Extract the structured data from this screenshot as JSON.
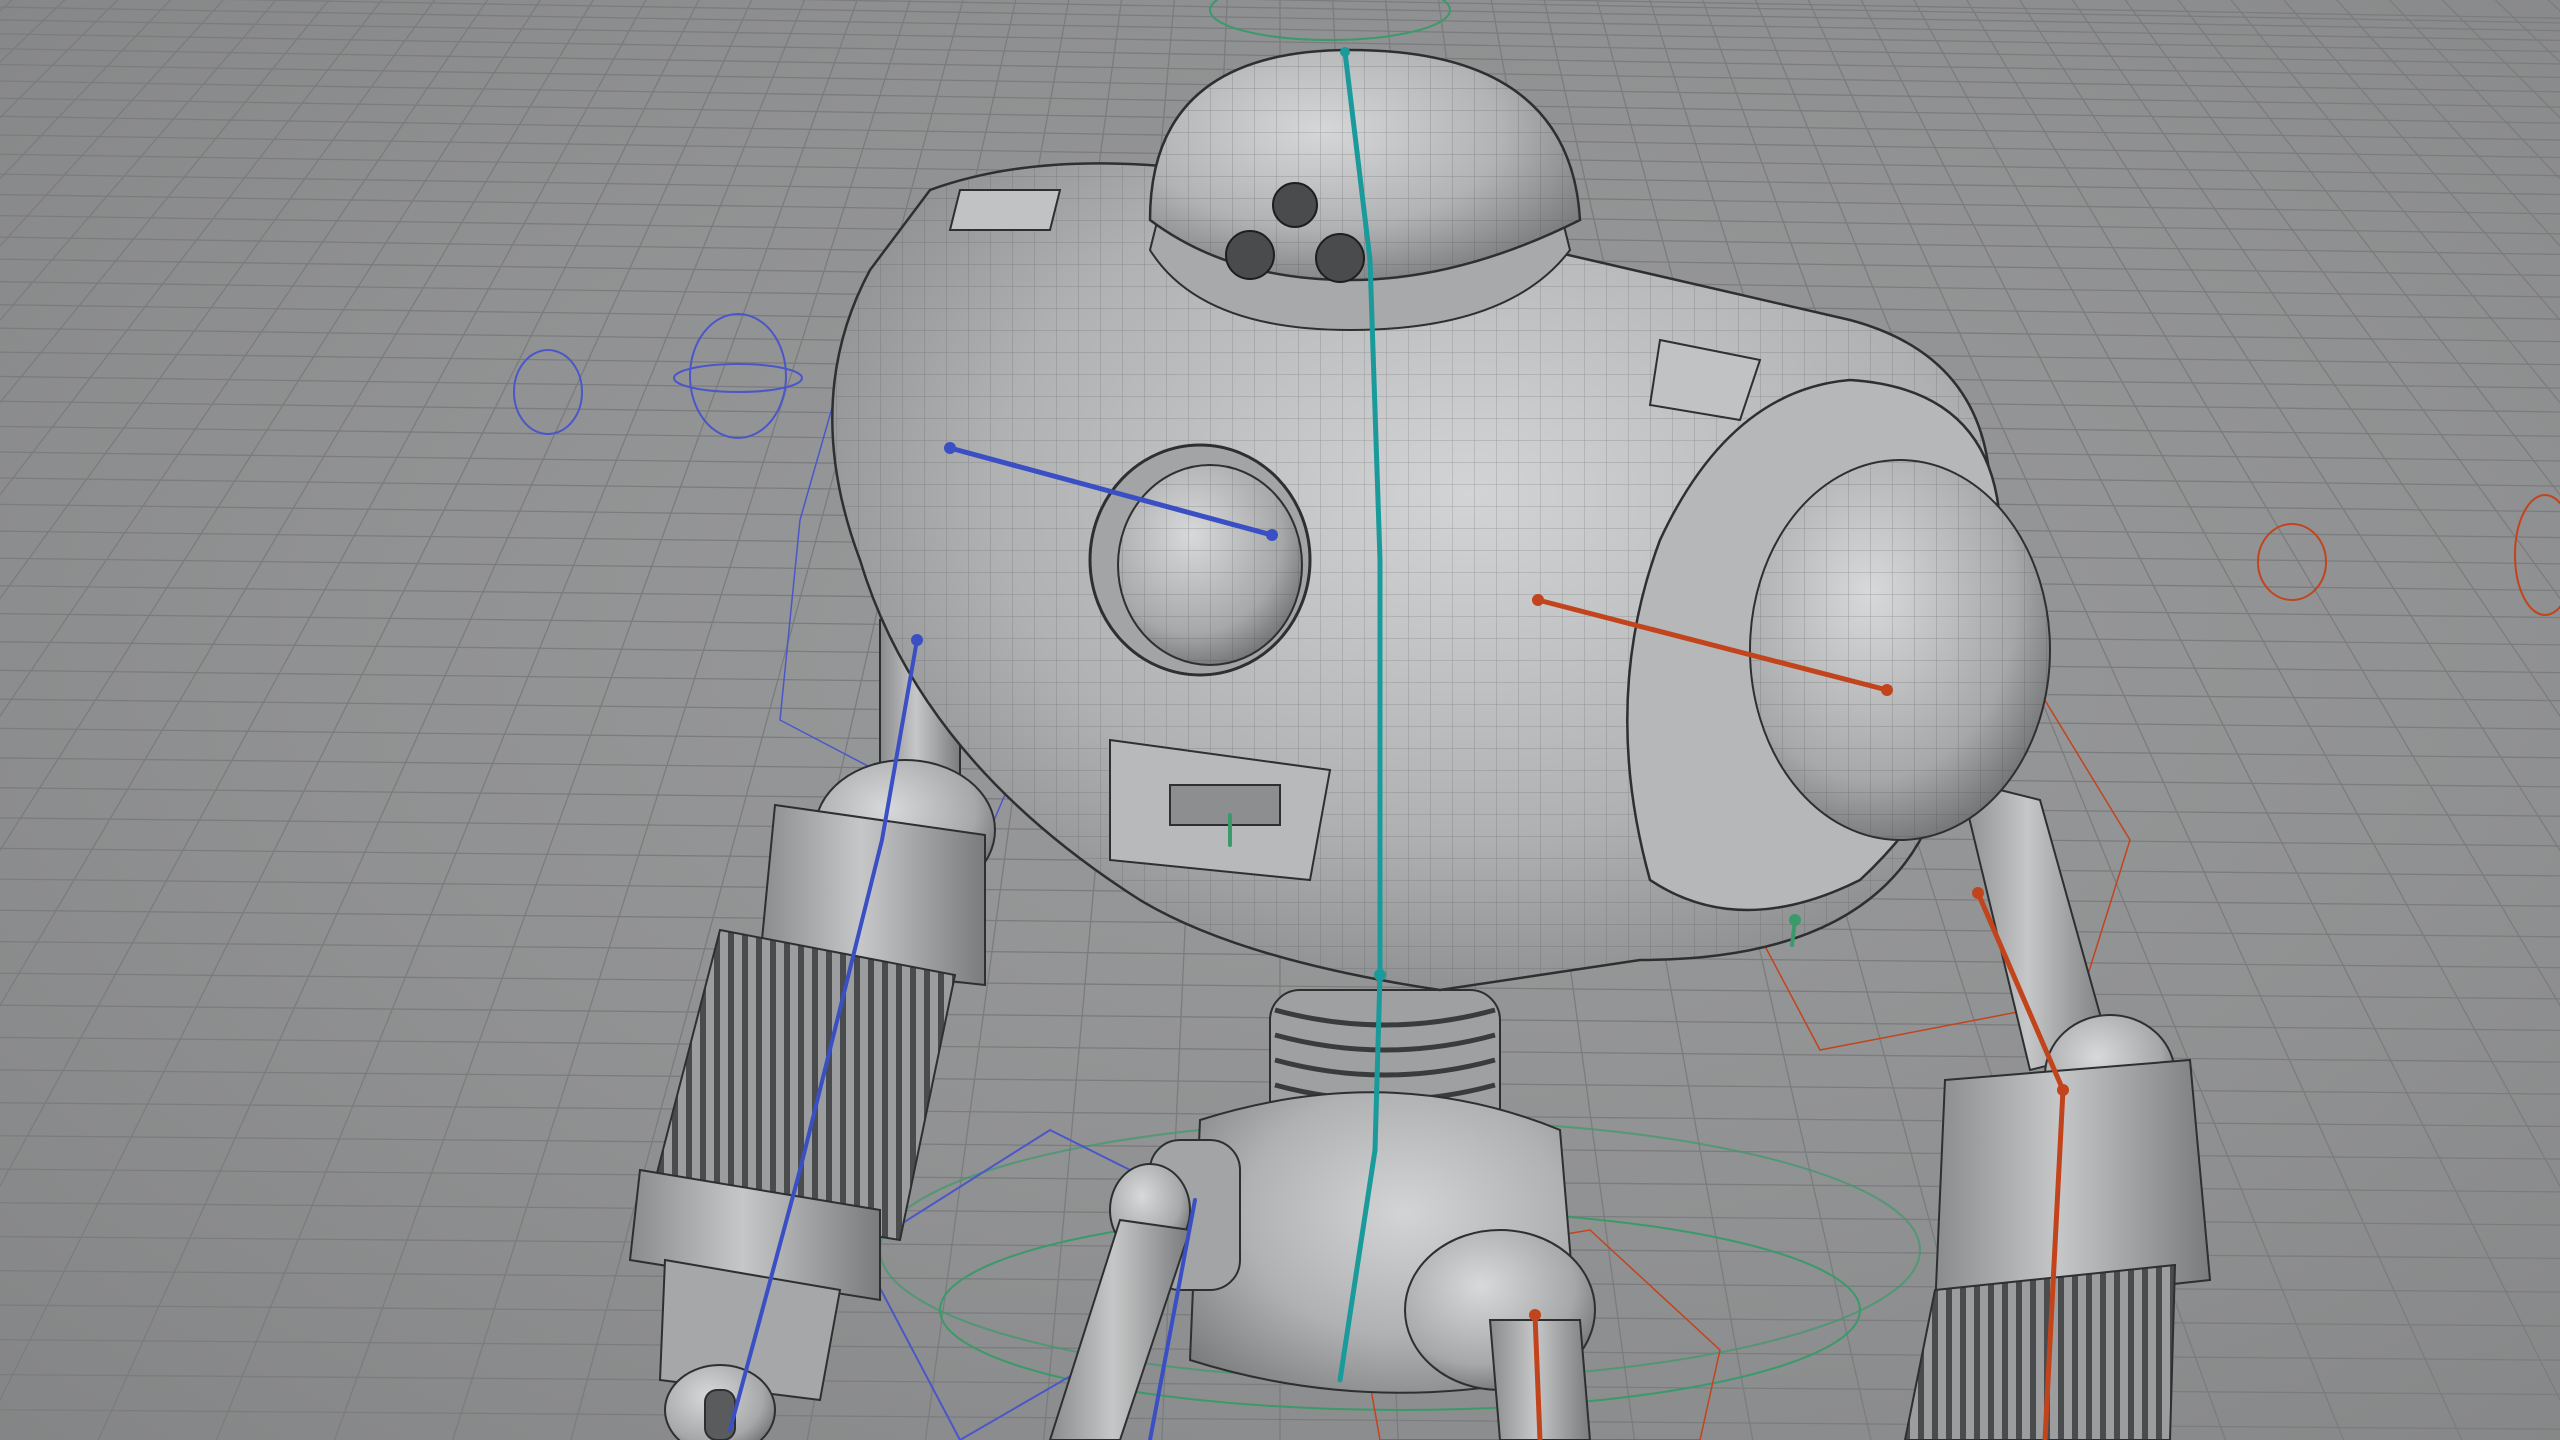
{
  "viewport": {
    "mode": "wireframe-on-shaded",
    "subject": "robot-rig",
    "colors": {
      "background": "#8e8f90",
      "grid": "#7b7c7d",
      "wire": "#2e2f30",
      "shade_light": "#c9cacb",
      "shade_mid": "#a9aaab",
      "shade_dark": "#6e6f70",
      "spine_bone": "#1a9a9a",
      "left_bone": "#3b4fc4",
      "right_bone": "#c2441c",
      "ctrl_green": "#3a9a6a"
    },
    "icons": [
      "grid-floor-icon",
      "joint-icon",
      "control-curve-icon"
    ]
  }
}
